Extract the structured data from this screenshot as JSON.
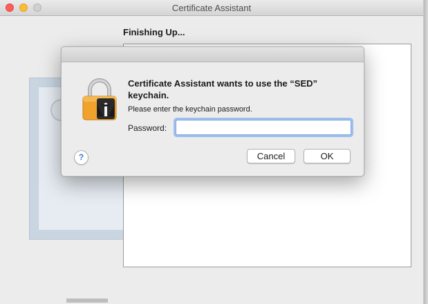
{
  "window": {
    "title": "Certificate Assistant",
    "heading": "Finishing Up..."
  },
  "dialog": {
    "title": "Certificate Assistant wants to use the “SED” keychain.",
    "message": "Please enter the keychain password.",
    "password_label": "Password:",
    "password_value": "",
    "help_label": "?",
    "cancel_label": "Cancel",
    "ok_label": "OK",
    "icon": "lock-icon"
  },
  "colors": {
    "close": "#fc5f57",
    "minimize": "#fdbc2e",
    "zoom_disabled": "#d0d0d0",
    "focus_ring": "#609aeb",
    "lock_body": "#f0a22c",
    "help_accent": "#3a7bd5"
  }
}
